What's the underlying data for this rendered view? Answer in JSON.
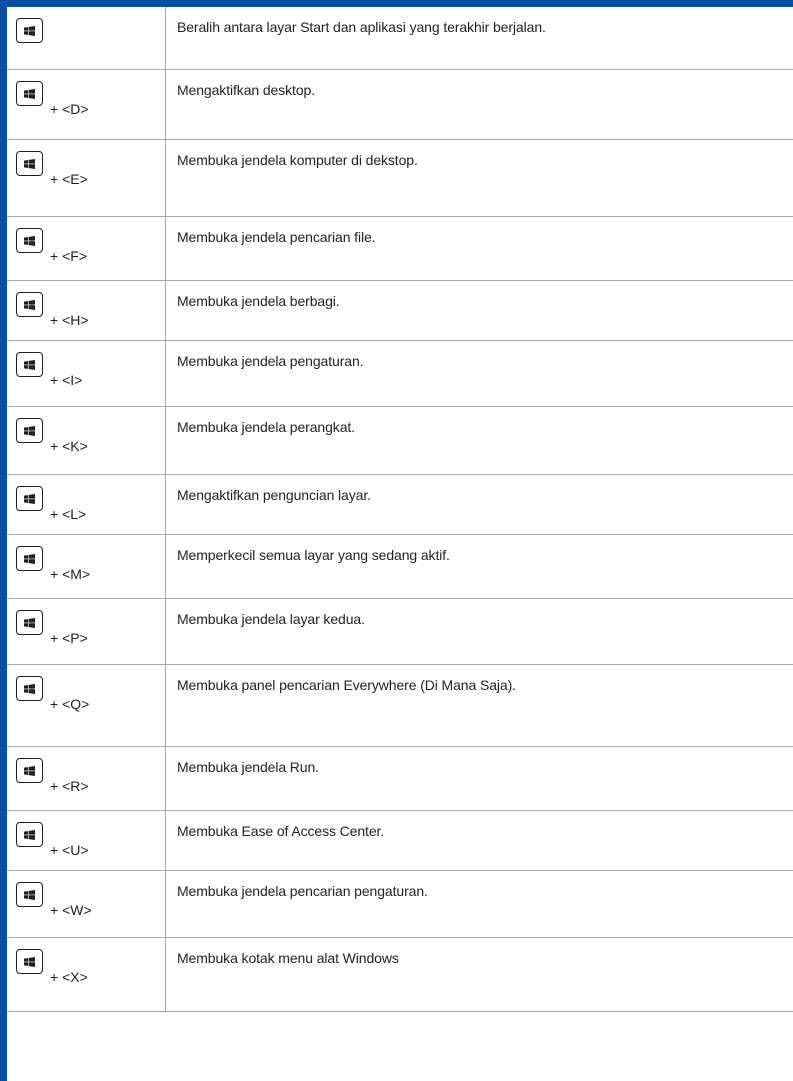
{
  "rows": [
    {
      "combo": "",
      "description": "Beralih antara layar Start dan aplikasi yang terakhir berjalan."
    },
    {
      "combo": "+ <D>",
      "description": "Mengaktifkan desktop."
    },
    {
      "combo": "+ <E>",
      "description": "Membuka jendela komputer di dekstop."
    },
    {
      "combo": "+ <F>",
      "description": "Membuka jendela pencarian file."
    },
    {
      "combo": "+ <H>",
      "description": "Membuka jendela berbagi."
    },
    {
      "combo": "+ <I>",
      "description": "Membuka jendela pengaturan."
    },
    {
      "combo": "+ <K>",
      "description": "Membuka jendela perangkat."
    },
    {
      "combo": "+ <L>",
      "description": "Mengaktifkan penguncian layar."
    },
    {
      "combo": "+ <M>",
      "description": "Memperkecil semua layar yang sedang aktif."
    },
    {
      "combo": "+ <P>",
      "description": "Membuka jendela layar kedua."
    },
    {
      "combo": "+ <Q>",
      "description": "Membuka panel pencarian Everywhere (Di Mana Saja)."
    },
    {
      "combo": "+ <R>",
      "description": "Membuka jendela Run."
    },
    {
      "combo": "+ <U>",
      "description": "Membuka Ease of Access Center."
    },
    {
      "combo": "+ <W>",
      "description": "Membuka jendela pencarian pengaturan."
    },
    {
      "combo": "+ <X>",
      "description": "Membuka kotak menu alat Windows"
    }
  ],
  "icons": {
    "key": "windows-key-icon"
  },
  "colors": {
    "accent_bar": "#0a4fa0",
    "grid_line": "#a7a9ac",
    "text": "#231f20"
  }
}
